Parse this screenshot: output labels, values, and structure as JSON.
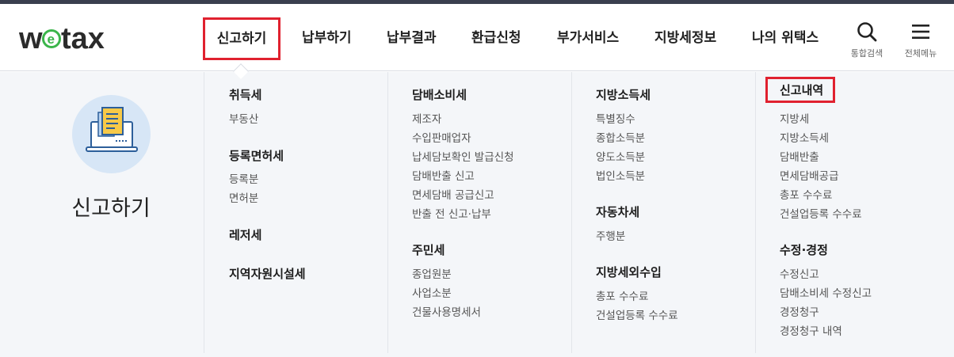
{
  "header": {
    "logo_text": "wetax",
    "nav": [
      "신고하기",
      "납부하기",
      "납부결과",
      "환급신청",
      "부가서비스",
      "지방세정보",
      "나의 위택스"
    ],
    "search_label": "통합검색",
    "menu_label": "전체메뉴"
  },
  "panel": {
    "hero_title": "신고하기",
    "columns": [
      {
        "groups": [
          {
            "title": "취득세",
            "items": [
              "부동산"
            ]
          },
          {
            "title": "등록면허세",
            "items": [
              "등록분",
              "면허분"
            ]
          },
          {
            "title": "레저세",
            "items": []
          },
          {
            "title": "지역자원시설세",
            "items": []
          }
        ]
      },
      {
        "groups": [
          {
            "title": "담배소비세",
            "items": [
              "제조자",
              "수입판매업자",
              "납세담보확인 발급신청",
              "담배반출 신고",
              "면세담배 공급신고",
              "반출 전 신고·납부"
            ]
          },
          {
            "title": "주민세",
            "items": [
              "종업원분",
              "사업소분",
              "건물사용명세서"
            ]
          }
        ]
      },
      {
        "groups": [
          {
            "title": "지방소득세",
            "items": [
              "특별징수",
              "종합소득분",
              "양도소득분",
              "법인소득분"
            ]
          },
          {
            "title": "자동차세",
            "items": [
              "주행분"
            ]
          },
          {
            "title": "지방세외수입",
            "items": [
              "총포 수수료",
              "건설업등록 수수료"
            ]
          }
        ]
      },
      {
        "groups": [
          {
            "title": "신고내역",
            "items": [
              "지방세",
              "지방소득세",
              "담배반출",
              "면세담배공급",
              "총포 수수료",
              "건설업등록 수수료"
            ]
          },
          {
            "title": "수정·경정",
            "items": [
              "수정신고",
              "담배소비세 수정신고",
              "경정청구",
              "경정청구 내역"
            ]
          }
        ]
      }
    ]
  },
  "colors": {
    "highlight": "#e0212f",
    "logo_green": "#3bb54a",
    "hero_circle": "#d7e6f6"
  }
}
